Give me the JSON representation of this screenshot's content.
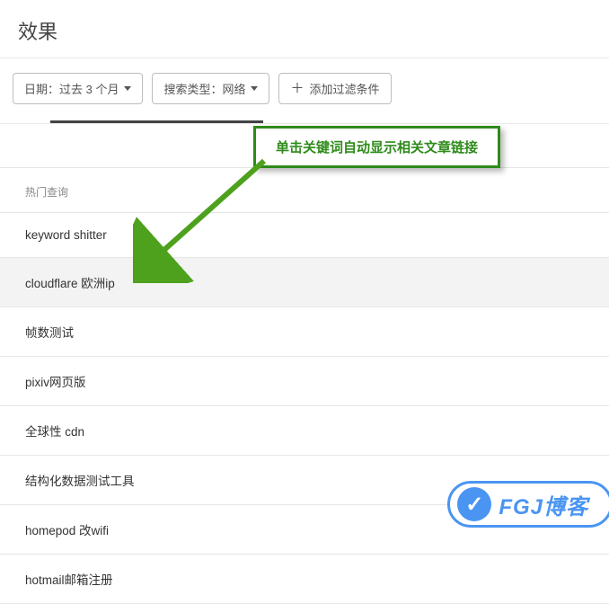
{
  "header": {
    "title": "效果"
  },
  "filters": {
    "date": {
      "label": "日期：过去 3 个月"
    },
    "type": {
      "label": "搜索类型：网络"
    },
    "add": {
      "label": "添加过滤条件"
    }
  },
  "callout": {
    "text": "单击关键词自动显示相关文章链接"
  },
  "list": {
    "header": "热门查询",
    "items": [
      {
        "label": "keyword shitter",
        "highlighted": false
      },
      {
        "label": "cloudflare 欧洲ip",
        "highlighted": true
      },
      {
        "label": "帧数测试",
        "highlighted": false
      },
      {
        "label": "pixiv网页版",
        "highlighted": false
      },
      {
        "label": "全球性 cdn",
        "highlighted": false
      },
      {
        "label": "结构化数据测试工具",
        "highlighted": false
      },
      {
        "label": "homepod 改wifi",
        "highlighted": false
      },
      {
        "label": "hotmail邮箱注册",
        "highlighted": false
      }
    ]
  },
  "watermark": {
    "text": "FGJ博客"
  }
}
